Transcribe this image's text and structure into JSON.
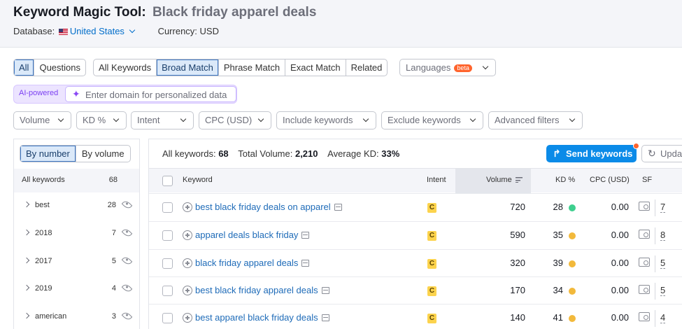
{
  "header": {
    "tool_title": "Keyword Magic Tool:",
    "query": "Black friday apparel deals",
    "database_label": "Database:",
    "database_value": "United States",
    "currency": "Currency: USD"
  },
  "tabs_type": [
    {
      "label": "All",
      "active": true
    },
    {
      "label": "Questions",
      "active": false
    }
  ],
  "tabs_match": [
    {
      "label": "All Keywords",
      "active": false
    },
    {
      "label": "Broad Match",
      "active": true
    },
    {
      "label": "Phrase Match",
      "active": false
    },
    {
      "label": "Exact Match",
      "active": false
    },
    {
      "label": "Related",
      "active": false
    }
  ],
  "languages": {
    "label": "Languages",
    "badge": "beta"
  },
  "ai": {
    "label": "AI-powered",
    "placeholder": "Enter domain for personalized data"
  },
  "filters": {
    "volume": "Volume",
    "kd": "KD %",
    "intent": "Intent",
    "cpc": "CPC (USD)",
    "include": "Include keywords",
    "exclude": "Exclude keywords",
    "advanced": "Advanced filters"
  },
  "sidebar": {
    "by_number": "By number",
    "by_volume": "By volume",
    "all_label": "All keywords",
    "all_count": "68",
    "groups": [
      {
        "label": "best",
        "count": "28"
      },
      {
        "label": "2018",
        "count": "7"
      },
      {
        "label": "2017",
        "count": "5"
      },
      {
        "label": "2019",
        "count": "4"
      },
      {
        "label": "american",
        "count": "3"
      }
    ]
  },
  "summary": {
    "all_keywords_label": "All keywords:",
    "all_keywords_value": "68",
    "total_volume_label": "Total Volume:",
    "total_volume_value": "2,210",
    "avg_kd_label": "Average KD:",
    "avg_kd_value": "33%"
  },
  "actions": {
    "send": "Send keywords",
    "update": "Update"
  },
  "table": {
    "headers": {
      "keyword": "Keyword",
      "intent": "Intent",
      "volume": "Volume",
      "kd": "KD %",
      "cpc": "CPC (USD)",
      "sf": "SF"
    },
    "rows": [
      {
        "keyword": "best black friday deals on apparel",
        "intent": "C",
        "volume": "720",
        "kd": "28",
        "kd_color": "#3ecf8e",
        "cpc": "0.00",
        "sf": "7"
      },
      {
        "keyword": "apparel deals black friday",
        "intent": "C",
        "volume": "590",
        "kd": "35",
        "kd_color": "#f2b93b",
        "cpc": "0.00",
        "sf": "8"
      },
      {
        "keyword": "black friday apparel deals",
        "intent": "C",
        "volume": "320",
        "kd": "39",
        "kd_color": "#f2b93b",
        "cpc": "0.00",
        "sf": "5"
      },
      {
        "keyword": "best black friday apparel deals",
        "intent": "C",
        "volume": "170",
        "kd": "34",
        "kd_color": "#f2b93b",
        "cpc": "0.00",
        "sf": "5"
      },
      {
        "keyword": "best apparel black friday deals",
        "intent": "C",
        "volume": "140",
        "kd": "41",
        "kd_color": "#f2b93b",
        "cpc": "0.00",
        "sf": "4"
      }
    ]
  }
}
